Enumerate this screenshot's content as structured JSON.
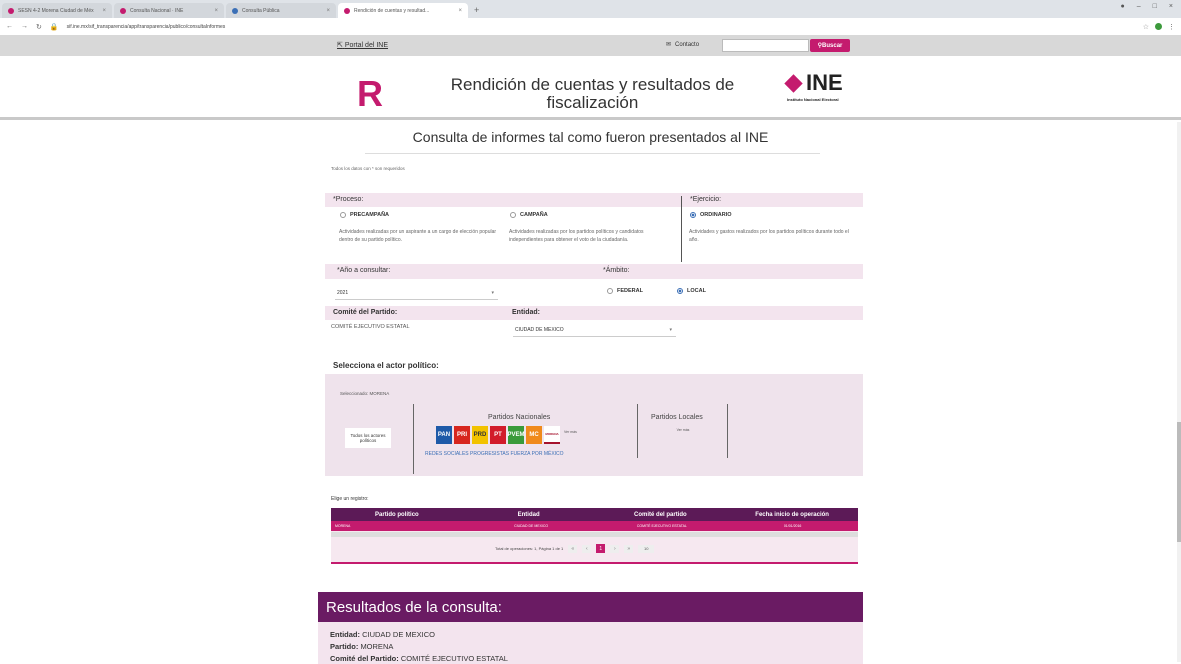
{
  "browser": {
    "tabs": [
      {
        "label": "SESN 4-2 Morena Ciudad de Méx",
        "active": false
      },
      {
        "label": "Consulta Nacional · INE",
        "active": false
      },
      {
        "label": "Consulta Pública",
        "active": false
      },
      {
        "label": "Rendición de cuentas y resultad...",
        "active": true
      }
    ],
    "new_tab": "+",
    "url": "sif.ine.mx/sif_transparencia/app/transparencia/publico/consultaInformes",
    "window_controls": [
      "●",
      "–",
      "□",
      "×"
    ]
  },
  "top_strip": {
    "portal_link": "Portal del INE",
    "contact": "Contacto",
    "search_placeholder": "",
    "search_button": "Buscar"
  },
  "header": {
    "logo_letter": "R",
    "title": "Rendición de cuentas y resultados de fiscalización",
    "ine_logo": "INE",
    "ine_sub": "Instituto Nacional Electoral"
  },
  "page": {
    "subtitle": "Consulta de informes tal como fueron presentados al INE",
    "required_note": "Todos los datos con * son requeridos"
  },
  "form": {
    "proceso_label": "*Proceso:",
    "ejercicio_label": "*Ejercicio:",
    "options": [
      {
        "label": "PRECAMPAÑA",
        "selected": false,
        "desc": "Actividades realizadas por un aspirante a un cargo de elección popular dentro de su partido político."
      },
      {
        "label": "CAMPAÑA",
        "selected": false,
        "desc": "Actividades realizadas por los partidos políticos y candidatos independientes para obtener el voto de la ciudadanía."
      },
      {
        "label": "ORDINARIO",
        "selected": true,
        "desc": "Actividades y gastos realizados por los partidos políticos durante todo el año."
      }
    ],
    "anio_label": "*Año a consultar:",
    "anio_value": "2021",
    "ambito_label": "*Ámbito:",
    "ambito_options": [
      {
        "label": "FEDERAL",
        "selected": false
      },
      {
        "label": "LOCAL",
        "selected": true
      }
    ],
    "comite_label": "Comité del Partido:",
    "comite_value": "COMITÉ EJECUTIVO ESTATAL",
    "entidad_label": "Entidad:",
    "entidad_value": "CIUDAD DE MEXICO"
  },
  "actor": {
    "title": "Selecciona el actor político:",
    "selected": "Seleccionado: MORENA",
    "todos_button": "Todos los actores políticos",
    "nacionales_title": "Partidos Nacionales",
    "locales_title": "Partidos Locales",
    "parties": [
      {
        "abbr": "PAN",
        "color": "#1e5aa8"
      },
      {
        "abbr": "PRI",
        "color": "#d7261e"
      },
      {
        "abbr": "PRD",
        "color": "#f2c200"
      },
      {
        "abbr": "PT",
        "color": "#d21c2a"
      },
      {
        "abbr": "PVEM",
        "color": "#3a9b3a"
      },
      {
        "abbr": "MC",
        "color": "#f08a1c"
      },
      {
        "abbr": "MORENA",
        "color": "#a6132d"
      }
    ],
    "more_nacionales": "Ver más",
    "links": "REDES SOCIALES PROGRESISTAS   FUERZA POR MÉXICO",
    "more_locales": "Ver más"
  },
  "table": {
    "elige": "Elige un registro:",
    "headers": [
      "Partido político",
      "Entidad",
      "Comité del partido",
      "Fecha inicio de operación"
    ],
    "rows": [
      [
        "MORENA",
        "CIUDAD DE MEXICO",
        "COMITÉ EJECUTIVO ESTATAL",
        "01/01/2016"
      ]
    ],
    "pager_text": "Total de operaciones: 1, Página 1 de 1",
    "current_page": "1",
    "page_size": "10"
  },
  "results": {
    "title": "Resultados de la consulta:",
    "entidad_label": "Entidad:",
    "entidad_value": "CIUDAD DE MEXICO",
    "partido_label": "Partido:",
    "partido_value": "MORENA",
    "comite_label": "Comité del Partido:",
    "comite_value": "COMITÉ EJECUTIVO ESTATAL"
  }
}
